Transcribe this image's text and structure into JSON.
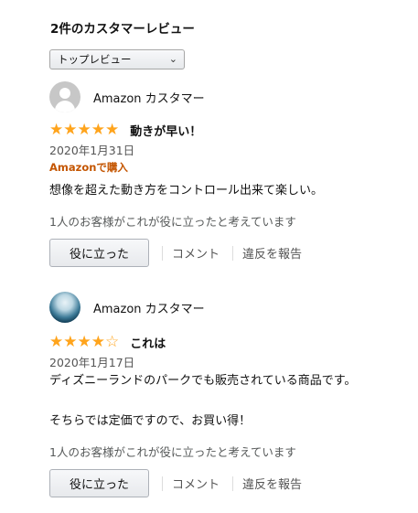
{
  "heading": "2件のカスタマーレビュー",
  "sort": {
    "selected": "トップレビュー"
  },
  "icons": {
    "chevron": "chevron-down-icon",
    "star": "star-icon",
    "avatar": "user-avatar-icon"
  },
  "colors": {
    "star": "#ffa41c",
    "badge": "#c45500",
    "muted": "#565959"
  },
  "reviews": [
    {
      "name": "Amazon カスタマー",
      "rating": 5,
      "title": "動きが早い！",
      "date": "2020年1月31日",
      "badge": "Amazonで購入",
      "body": "想像を超えた動き方をコントロール出来て楽しい。",
      "helpful": "1人のお客様がこれが役に立ったと考えています",
      "helpful_button": "役に立った",
      "comment": "コメント",
      "report": "違反を報告"
    },
    {
      "name": "Amazon カスタマー",
      "rating": 4,
      "title": "これは",
      "date": "2020年1月17日",
      "body_line1": "ディズニーランドのパークでも販売されている商品です。",
      "body_line2": "そちらでは定価ですので、お買い得！",
      "helpful": "1人のお客様がこれが役に立ったと考えています",
      "helpful_button": "役に立った",
      "comment": "コメント",
      "report": "違反を報告"
    }
  ]
}
